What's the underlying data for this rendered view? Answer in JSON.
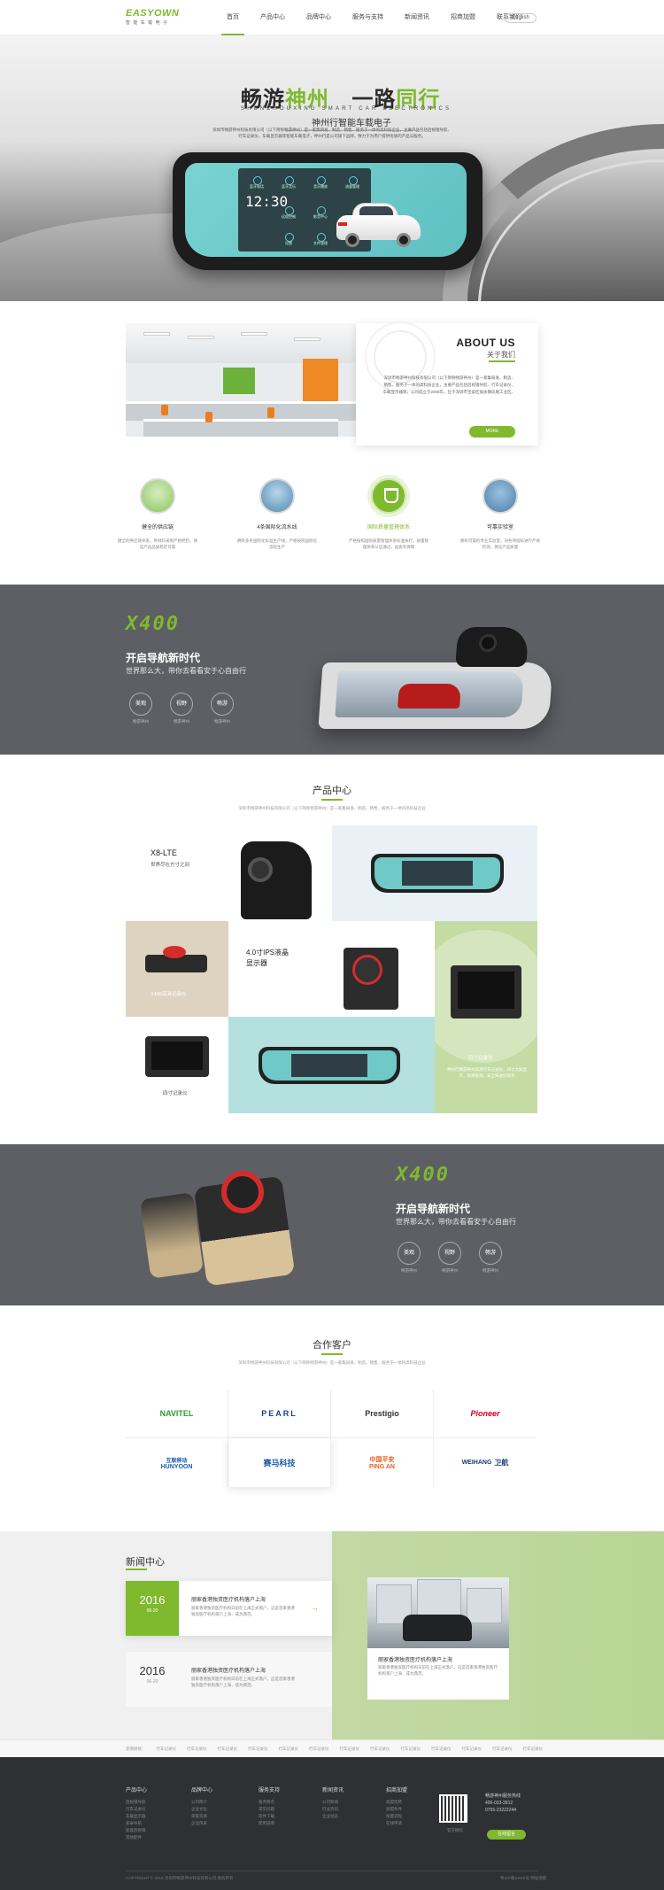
{
  "header": {
    "logo_brand": "EASYOWN",
    "logo_cn": "神州行",
    "logo_sub": "智 能 车 载 电 子",
    "nav": [
      "首页",
      "产品中心",
      "品牌中心",
      "服务与支持",
      "新闻资讯",
      "招商加盟",
      "联系我们"
    ],
    "lang": "English"
  },
  "hero": {
    "title_a": "畅游",
    "title_b": "神州",
    "title_c": "一路",
    "title_d": "同行",
    "en": "SHENZHOUXING SMART CAR ELECTRONICS",
    "sub": "神州行智能车载电子",
    "desc": "深圳市畅游神州科技有限公司（以下简称畅游神州）是一家集研发、制造、销售、服务于一体的高科技企业，主要产品包括后视镜导航、行车记录仪、车载显示器等智能车载电子，神州行是公司旗下品牌，致力于为用户提供优质的产品与服务。",
    "clock": "12:30",
    "tiles": [
      "蓝牙电话",
      "蓝牙音乐",
      "音乐播放",
      "流量管理",
      "远程控制",
      "影音中心",
      "设置",
      "文件管理"
    ]
  },
  "about": {
    "title": "ABOUT US",
    "subtitle": "关于我们",
    "text": "深圳市畅游神州科技有限公司（以下简称畅游神州）是一家集研发、制造、销售、服务于一体的高科技企业，主要产品包括后视镜导航、行车记录仪、车载显示器等，公司成立于2008年，位于深圳市宝安区福永镇凤凰工业区。",
    "more": "MORE",
    "features": [
      {
        "title": "健全的供应链",
        "desc": "健全的供应链体系，原材料采购严格把控，保证产品品质稳定可靠"
      },
      {
        "title": "4条国际化流水线",
        "desc": "拥有多条国际化标准生产线，严格按照国际化流程生产"
      },
      {
        "title": "国际质量管理体系",
        "desc": "严格按照国际质量管理体系标准执行，质量管理体系认证通过，品质有保障"
      },
      {
        "title": "可靠实验室",
        "desc": "拥有可靠的专业实验室，对各项指标进行严格检测，保证产品质量"
      }
    ]
  },
  "band1": {
    "model": "X400",
    "heading": "开启导航新时代",
    "slogan": "世界那么大，带你去看看安于心自由行",
    "circles": [
      {
        "label": "美观",
        "cap": "畅游神州"
      },
      {
        "label": "视野",
        "cap": "畅游神州"
      },
      {
        "label": "畅游",
        "cap": "畅游神州"
      }
    ]
  },
  "products": {
    "title": "产品中心",
    "desc": "深圳市畅游神州科技有限公司（以下简称畅游神州）是一家集研发、制造、销售、服务于一体的高科技企业",
    "items": {
      "p1_name": "X8-LTE",
      "p1_desc": "世界尽在方寸之间",
      "p3_name": "X400高清记录仪",
      "p4_name": "4.0寸IPS液晶",
      "p4_name2": "显示器",
      "p6_name": "四寸记录仪",
      "p6_desc": "神州行畅游神州高清行车记录仪，四寸大屏显示，高清夜视，安全驾驶好帮手",
      "p7_name": "四寸记录仪"
    }
  },
  "band2": {
    "model": "X400",
    "heading": "开启导航新时代",
    "slogan": "世界那么大，带你去看看安于心自由行",
    "circles": [
      {
        "label": "美观",
        "cap": "畅游神州"
      },
      {
        "label": "视野",
        "cap": "畅游神州"
      },
      {
        "label": "畅游",
        "cap": "畅游神州"
      }
    ]
  },
  "partners": {
    "title": "合作客户",
    "desc": "深圳市畅游神州科技有限公司（以下简称畅游神州）是一家集研发、制造、销售、服务于一体的高科技企业",
    "logos": [
      "NAVITEL",
      "PEARL",
      "Prestigio",
      "Pioneer",
      "HUNYOON",
      "赛马科技",
      "PING AN",
      "WEIHANG"
    ],
    "logo_cn": [
      "互联移动",
      "中国平安",
      "卫航"
    ],
    "colors": {
      "navitel": "#2d9b3a",
      "pearl": "#1e3f8c",
      "prestigio": "#c8102e",
      "pioneer": "#d4001e",
      "hunyoon": "#1b5ea8",
      "pingan": "#e85d1e",
      "weihang": "#1b3e7a"
    }
  },
  "news": {
    "title": "新闻中心",
    "items": [
      {
        "year": "2016",
        "md": "06-20",
        "title": "丽家香港独资医疗机构落户上海",
        "desc": "丽家香港独资医疗机构日前在上海正式落户，这是首家香港独资医疗机构落户上海，成为典范。"
      },
      {
        "year": "2016",
        "md": "06-20",
        "title": "丽家香港独资医疗机构落户上海",
        "desc": "丽家香港独资医疗机构日前在上海正式落户，这是首家香港独资医疗机构落户上海，成为典范。"
      }
    ],
    "card_title": "丽家香港独资医疗机构落户上海",
    "card_desc": "丽家香港独资医疗机构日前在上海正式落户，这是首家香港独资医疗机构落户上海，成为典范。",
    "arrow": "→"
  },
  "links": [
    "友情链接：",
    "行车记录仪",
    "行车记录仪",
    "行车记录仪",
    "行车记录仪",
    "行车记录仪",
    "行车记录仪",
    "行车记录仪",
    "行车记录仪",
    "行车记录仪",
    "行车记录仪",
    "行车记录仪",
    "行车记录仪",
    "行车记录仪"
  ],
  "footer": {
    "cols": [
      {
        "h": "产品中心",
        "items": [
          "后视镜导航",
          "行车记录仪",
          "车载显示器",
          "安卓导航",
          "智能后视镜",
          "其他配件"
        ]
      },
      {
        "h": "品牌中心",
        "items": [
          "公司简介",
          "企业文化",
          "荣誉资质",
          "企业风采"
        ]
      },
      {
        "h": "服务支持",
        "items": [
          "服务网点",
          "常见问题",
          "软件下载",
          "使用说明"
        ]
      },
      {
        "h": "新闻资讯",
        "items": [
          "公司新闻",
          "行业资讯",
          "企业动态"
        ]
      },
      {
        "h": "招商加盟",
        "items": [
          "加盟优势",
          "加盟条件",
          "加盟流程",
          "在线申请"
        ]
      }
    ],
    "qr_caption": "官方微信",
    "hotline_label": "畅游神州服务热线",
    "phone1": "400-033-2812",
    "phone2": "0755-23222244",
    "online_btn": "在线留言",
    "copyright": "COPYRIGHT © 2016 深圳市畅游神州科技有限公司 版权所有",
    "right": "粤ICP备XXXX号  网站地图"
  }
}
